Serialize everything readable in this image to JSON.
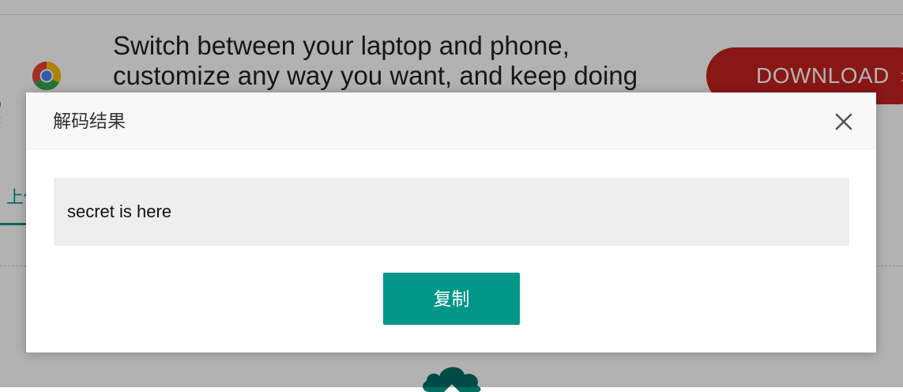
{
  "background": {
    "ad": {
      "line1": "Switch between your laptop and phone,",
      "line2": "customize any way you want, and keep doing",
      "download_label": "DOWNLOAD",
      "download_chevron": "›",
      "logo_icon": "chrome-logo-icon"
    },
    "tab_partial_label": "上传",
    "accent_color": "#009688"
  },
  "dialog": {
    "title": "解码结果",
    "close_icon": "close-icon",
    "result_text": "secret is here",
    "copy_label": "复制"
  }
}
